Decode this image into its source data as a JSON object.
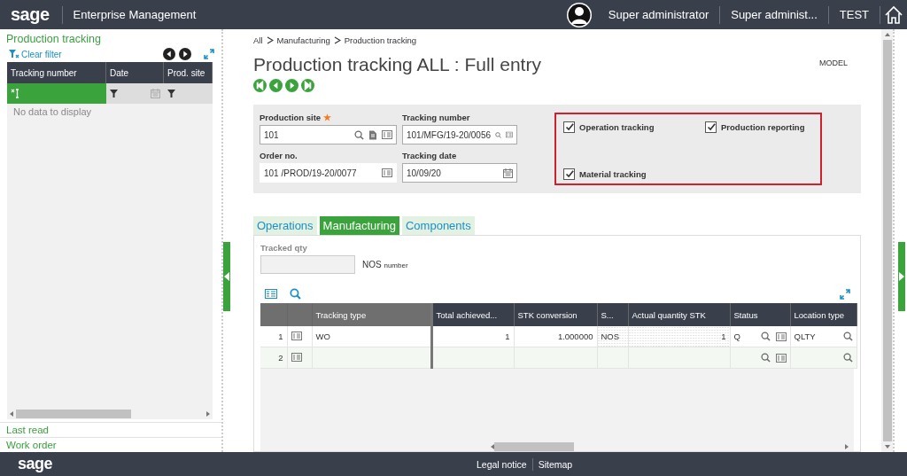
{
  "header": {
    "logo": "sage",
    "app_title": "Enterprise Management",
    "user": "Super administrator",
    "role": "Super administ...",
    "folder": "TEST"
  },
  "left_panel": {
    "title": "Production tracking",
    "clear_filter": "Clear filter",
    "columns": [
      "Tracking number",
      "Date",
      "Prod. site"
    ],
    "empty_message": "No data to display",
    "links": [
      "Last read",
      "Work order"
    ]
  },
  "breadcrumb": [
    "All",
    "Manufacturing",
    "Production tracking"
  ],
  "page": {
    "title": "Production tracking ALL : Full entry",
    "mode": "MODEL"
  },
  "required_mark": "★",
  "fields": [
    {
      "kind": "site",
      "label": "Production site",
      "required": true,
      "value": "101"
    },
    {
      "kind": "lookup",
      "label": "Tracking number",
      "required": false,
      "value": "101/MFG/19-20/0056"
    },
    {
      "kind": "link",
      "label": "Order no.",
      "required": false,
      "value": "101 /PROD/19-20/0077"
    },
    {
      "kind": "date",
      "label": "Tracking date",
      "required": false,
      "value": "10/09/20"
    }
  ],
  "checkboxes": [
    {
      "label": "Operation tracking",
      "checked": true
    },
    {
      "label": "Production reporting",
      "checked": true
    },
    {
      "label": "Material tracking",
      "checked": true
    }
  ],
  "tabs": [
    {
      "label": "Operations",
      "selected": false
    },
    {
      "label": "Manufacturing",
      "selected": true
    },
    {
      "label": "Components",
      "selected": false
    }
  ],
  "tracked_qty": {
    "label": "Tracked qty",
    "unit": "NOS",
    "unit_note": "number"
  },
  "grid": {
    "columns": [
      "Tracking type",
      "Total achieved...",
      "STK conversion",
      "S...",
      "Actual quantity STK",
      "Status",
      "Location type"
    ],
    "rows": [
      {
        "number": "1",
        "tracking_type": "WO",
        "total": "1",
        "conversion": "1.000000",
        "unit": "NOS",
        "actual": "1",
        "status": "Q",
        "location_type": "QLTY"
      },
      {
        "number": "2"
      }
    ]
  },
  "footer": {
    "logo": "sage",
    "links": [
      "Legal notice",
      "Sitemap"
    ]
  }
}
